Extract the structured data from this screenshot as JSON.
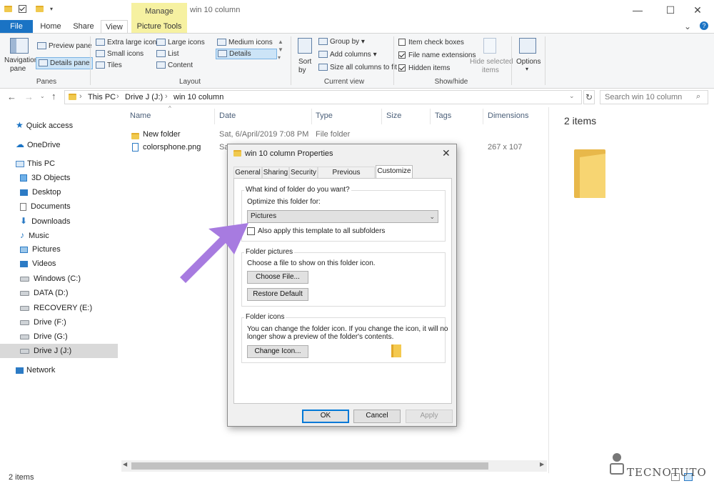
{
  "window": {
    "title": "win 10 column",
    "context_tab": "Manage",
    "minimize": "—",
    "maximize": "☐",
    "close": "✕",
    "help": "?"
  },
  "ribbon_tabs": [
    "File",
    "Home",
    "Share",
    "View",
    "Picture Tools"
  ],
  "ribbon": {
    "panes": {
      "nav_pane": "Navigation",
      "nav_pane2": "pane",
      "preview_pane": "Preview pane",
      "details_pane": "Details pane",
      "group": "Panes"
    },
    "layout": {
      "items": [
        "Extra large icons",
        "Large icons",
        "Medium icons",
        "Small icons",
        "List",
        "Details",
        "Tiles",
        "Content"
      ],
      "group": "Layout"
    },
    "current_view": {
      "sort_by": "Sort",
      "sort_by2": "by",
      "group_by": "Group by",
      "add_columns": "Add columns",
      "size_columns": "Size all columns to fit",
      "group": "Current view"
    },
    "show_hide": {
      "item_checkboxes": "Item check boxes",
      "file_name_ext": "File name extensions",
      "hidden_items": "Hidden items",
      "hide_selected": "Hide selected",
      "hide_selected2": "items",
      "group": "Show/hide"
    },
    "options": "Options"
  },
  "address": {
    "path": [
      "This PC",
      "Drive J (J:)",
      "win 10 column"
    ],
    "search_placeholder": "Search win 10 column"
  },
  "nav": {
    "quick_access": "Quick access",
    "onedrive": "OneDrive",
    "this_pc": "This PC",
    "items": [
      "3D Objects",
      "Desktop",
      "Documents",
      "Downloads",
      "Music",
      "Pictures",
      "Videos",
      "Windows (C:)",
      "DATA (D:)",
      "RECOVERY (E:)",
      "Drive (F:)",
      "Drive (G:)",
      "Drive J (J:)"
    ],
    "network": "Network"
  },
  "columns": [
    "Name",
    "Date",
    "Type",
    "Size",
    "Tags",
    "Dimensions"
  ],
  "files": [
    {
      "name": "New folder",
      "date": "Sat, 6/April/2019 7:08 PM",
      "type": "File folder",
      "dimensions": ""
    },
    {
      "name": "colorsphone.png",
      "date": "Sa",
      "type": "",
      "dimensions": "267 x 107"
    }
  ],
  "details_pane": {
    "count": "2 items"
  },
  "status": {
    "count": "2 items"
  },
  "dialog": {
    "title": "win 10 column Properties",
    "tabs": [
      "General",
      "Sharing",
      "Security",
      "Previous Versions",
      "Customize"
    ],
    "q": "What kind of folder do you want?",
    "optimize_label": "Optimize this folder for:",
    "optimize_value": "Pictures",
    "apply_subfolders": "Also apply this template to all subfolders",
    "folder_pictures": "Folder pictures",
    "choose_file_text": "Choose a file to show on this folder icon.",
    "choose_file": "Choose File...",
    "restore_default": "Restore Default",
    "folder_icons": "Folder icons",
    "icons_text1": "You can change the folder icon. If you change the icon, it will no",
    "icons_text2": "longer show a preview of the folder's contents.",
    "change_icon": "Change Icon...",
    "ok": "OK",
    "cancel": "Cancel",
    "apply": "Apply"
  },
  "watermark": "TECNOTUTO",
  "colors": {
    "accent": "#1a73c4",
    "arrow": "#a77be0",
    "folder": "#f0c94e"
  }
}
